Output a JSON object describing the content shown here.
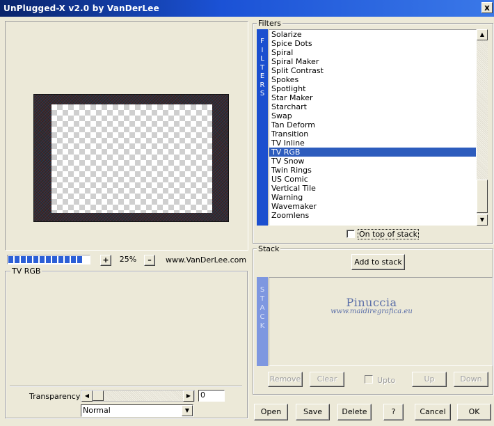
{
  "window": {
    "title": "UnPlugged-X v2.0 by VanDerLee",
    "close_glyph": "x"
  },
  "preview": {
    "zoom": "25%",
    "zoom_in_glyph": "+",
    "zoom_out_glyph": "–",
    "website": "www.VanDerLee.com",
    "progress_segments": 12
  },
  "params": {
    "group_label": "TV RGB"
  },
  "filters": {
    "group_label": "Filters",
    "strip_label": "F I L T E R S",
    "items": [
      "Solarize",
      "Spice Dots",
      "Spiral",
      "Spiral Maker",
      "Split Contrast",
      "Spokes",
      "Spotlight",
      "Star Maker",
      "Starchart",
      "Swap",
      "Tan Deform",
      "Transition",
      "TV Inline",
      "TV RGB",
      "TV Snow",
      "Twin Rings",
      "US Comic",
      "Vertical Tile",
      "Warning",
      "Wavemaker",
      "Zoomlens"
    ],
    "selected": "TV RGB",
    "on_top_label": "On top of stack"
  },
  "stack": {
    "group_label": "Stack",
    "add_label": "Add to stack",
    "strip_label": "S T A C K",
    "watermark_name": "Pinuccia",
    "watermark_site": "www.maidiregrafica.eu",
    "remove_label": "Remove",
    "clear_label": "Clear",
    "upto_label": "Upto",
    "up_label": "Up",
    "down_label": "Down"
  },
  "transparency": {
    "label": "Transparency",
    "value": "0",
    "blend_mode": "Normal"
  },
  "buttons": {
    "open": "Open",
    "save": "Save",
    "delete": "Delete",
    "help": "?",
    "cancel": "Cancel",
    "ok": "OK"
  },
  "colors": {
    "title_bar": "#1b52d6",
    "selection": "#2d5cbd",
    "filter_strip": "#1b4fcf",
    "stack_strip": "#7e97e0"
  }
}
